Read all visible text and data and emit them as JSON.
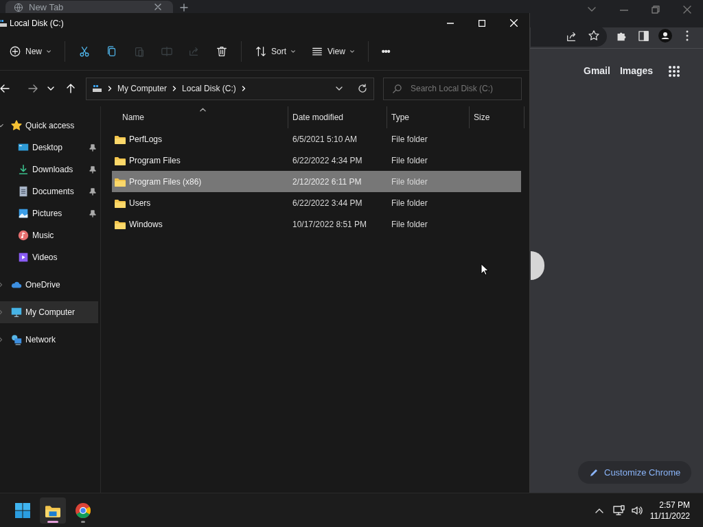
{
  "browser": {
    "tab": {
      "title": "New Tab",
      "selected": true
    },
    "header_links": [
      "Gmail",
      "Images"
    ],
    "customize_button": "Customize Chrome"
  },
  "explorer": {
    "window": {
      "title": "Local Disk (C:)"
    },
    "toolbar_groups": [
      {
        "items": [
          {
            "kind": "new",
            "label": "New",
            "disabled": false
          }
        ]
      },
      {
        "items": [
          {
            "kind": "cut",
            "disabled": false
          },
          {
            "kind": "copy",
            "disabled": false
          },
          {
            "kind": "paste",
            "disabled": true
          },
          {
            "kind": "rename",
            "disabled": true
          },
          {
            "kind": "share",
            "disabled": true
          },
          {
            "kind": "delete",
            "disabled": false
          }
        ]
      },
      {
        "items": [
          {
            "kind": "sort",
            "label": "Sort",
            "disabled": false
          },
          {
            "kind": "view",
            "label": "View",
            "disabled": false
          }
        ]
      },
      {
        "items": [
          {
            "kind": "more",
            "label": "•••",
            "disabled": false
          }
        ]
      }
    ],
    "address": {
      "path": [
        "My Computer",
        "Local Disk (C:)"
      ]
    },
    "search": {
      "placeholder": "Search Local Disk (C:)"
    },
    "sidebar": {
      "items": [
        {
          "kind": "quick",
          "label": "Quick access",
          "expanded": true,
          "selected": false,
          "children": [
            {
              "kind": "desktop",
              "label": "Desktop",
              "pinned": true,
              "selected": false
            },
            {
              "kind": "downloads",
              "label": "Downloads",
              "pinned": true,
              "selected": false
            },
            {
              "kind": "documents",
              "label": "Documents",
              "pinned": true,
              "selected": false
            },
            {
              "kind": "pictures",
              "label": "Pictures",
              "pinned": true,
              "selected": false
            },
            {
              "kind": "music",
              "label": "Music",
              "pinned": false,
              "selected": false
            },
            {
              "kind": "videos",
              "label": "Videos",
              "pinned": false,
              "selected": false
            }
          ]
        },
        {
          "kind": "onedrive",
          "label": "OneDrive",
          "expanded": false,
          "selected": false
        },
        {
          "kind": "computer",
          "label": "My Computer",
          "expanded": false,
          "selected": true
        },
        {
          "kind": "network",
          "label": "Network",
          "expanded": false,
          "selected": false
        }
      ]
    },
    "table": {
      "columns": [
        {
          "label": "Name",
          "sorted": true
        },
        {
          "label": "Date modified",
          "sorted": false
        },
        {
          "label": "Type",
          "sorted": false
        },
        {
          "label": "Size",
          "sorted": false
        }
      ],
      "rows": [
        {
          "name": "PerfLogs",
          "date": "6/5/2021 5:10 AM",
          "type": "File folder",
          "selected": false
        },
        {
          "name": "Program Files",
          "date": "6/22/2022 4:34 PM",
          "type": "File folder",
          "selected": false
        },
        {
          "name": "Program Files (x86)",
          "date": "2/12/2022 6:11 PM",
          "type": "File folder",
          "selected": true
        },
        {
          "name": "Users",
          "date": "6/22/2022 3:44 PM",
          "type": "File folder",
          "selected": false
        },
        {
          "name": "Windows",
          "date": "10/17/2022 8:51 PM",
          "type": "File folder",
          "selected": false
        }
      ]
    }
  },
  "taskbar": {
    "apps": [
      {
        "kind": "start",
        "active": false
      },
      {
        "kind": "explorer",
        "active": true
      },
      {
        "kind": "chrome",
        "active": false
      }
    ],
    "clock": {
      "time": "2:57 PM",
      "date": "11/11/2022"
    }
  }
}
